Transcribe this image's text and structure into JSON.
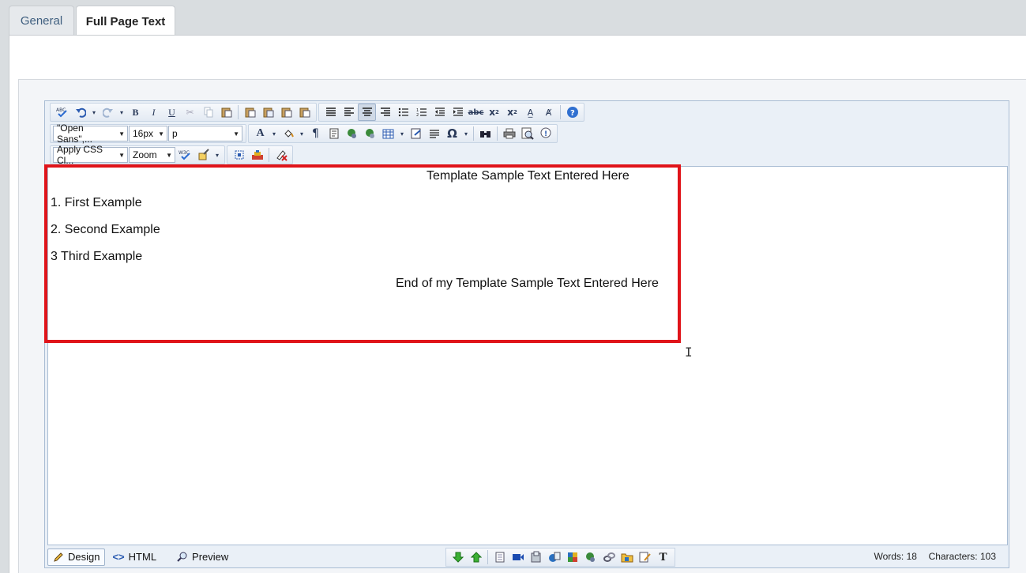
{
  "tabs": [
    {
      "label": "General",
      "active": false
    },
    {
      "label": "Full Page Text",
      "active": true
    }
  ],
  "toolbar": {
    "font_family": "\"Open Sans\",...",
    "font_size": "16px",
    "block_format": "p",
    "css_class": "Apply CSS Cl...",
    "zoom": "Zoom"
  },
  "document": {
    "line1": "Template Sample Text Entered Here",
    "line2": "1. First Example",
    "line3": "2. Second Example",
    "line4": "3 Third Example",
    "line5": "End of my Template Sample Text Entered Here"
  },
  "modes": {
    "design": "Design",
    "html": "HTML",
    "preview": "Preview"
  },
  "stats": {
    "words": "Words: 18",
    "characters": "Characters: 103"
  },
  "colors": {
    "highlight": "#e0141a",
    "accent": "#3f5f7f"
  }
}
